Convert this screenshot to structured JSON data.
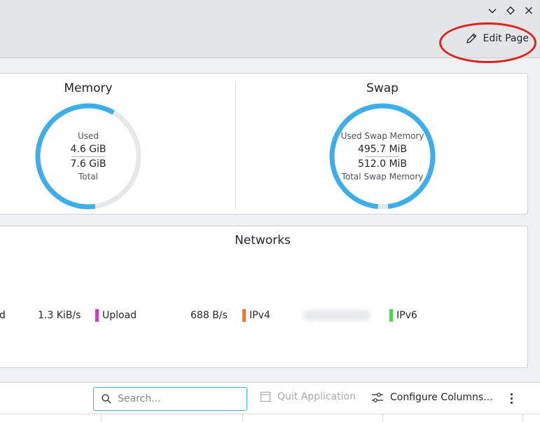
{
  "window": {
    "controls": [
      "chevron-down-icon",
      "diamond-icon",
      "close-icon"
    ]
  },
  "header": {
    "edit_page_label": "Edit Page"
  },
  "memory": {
    "title": "Memory",
    "used_label": "Used",
    "used_value": "4.6 GiB",
    "total_value": "7.6 GiB",
    "total_label": "Total",
    "fraction": 0.605
  },
  "swap": {
    "title": "Swap",
    "used_label": "Used Swap Memory",
    "used_value": "495.7 MiB",
    "total_value": "512.0 MiB",
    "total_label": "Total Swap Memory",
    "fraction": 0.968
  },
  "networks": {
    "title": "Networks",
    "partial_label": "d",
    "upload_rate": "1.3 KiB/s",
    "upload_label": "Upload",
    "rate2": "688 B/s",
    "ipv4_label": "IPv4",
    "ipv6_label": "IPv6",
    "colors": {
      "upload": "#c341c6",
      "ipv4": "#e07b39",
      "ipv6": "#55d24f"
    }
  },
  "toolbar": {
    "search_placeholder": "Search...",
    "quit_label": "Quit Application",
    "configure_label": "Configure Columns..."
  },
  "colors": {
    "accent": "#3daee9",
    "track": "#e6e7e8"
  }
}
